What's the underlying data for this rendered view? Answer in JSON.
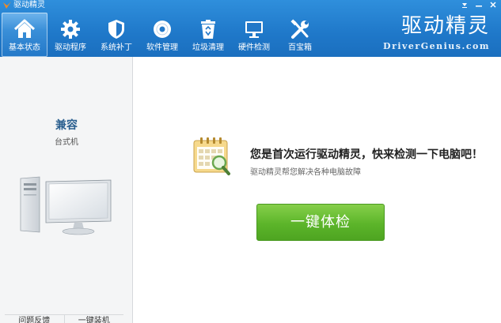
{
  "window": {
    "title": "驱动精灵",
    "controls": [
      "menu-icon",
      "minimize-icon",
      "close-icon"
    ]
  },
  "toolbar": {
    "items": [
      {
        "label": "基本状态",
        "icon": "home-icon",
        "active": true
      },
      {
        "label": "驱动程序",
        "icon": "gear-icon",
        "active": false
      },
      {
        "label": "系统补丁",
        "icon": "shield-icon",
        "active": false
      },
      {
        "label": "软件管理",
        "icon": "disc-icon",
        "active": false
      },
      {
        "label": "垃圾清理",
        "icon": "recycle-bin-icon",
        "active": false
      },
      {
        "label": "硬件检测",
        "icon": "monitor-icon",
        "active": false
      },
      {
        "label": "百宝箱",
        "icon": "tools-icon",
        "active": false
      }
    ]
  },
  "brand": {
    "name_cn": "驱动精灵",
    "name_en": "DriverGenius.com"
  },
  "sidebar": {
    "model": "兼容",
    "type": "台式机",
    "footer_links": [
      "问题反馈",
      "一键装机"
    ]
  },
  "main": {
    "headline": "您是首次运行驱动精灵，快来检测一下电脑吧！",
    "subline": "驱动精灵帮您解决各种电脑故障",
    "scan_button": "一键体检"
  },
  "colors": {
    "header_blue": "#1f78c9",
    "button_green": "#5cb52a",
    "brand_accent": "#f08a24"
  }
}
